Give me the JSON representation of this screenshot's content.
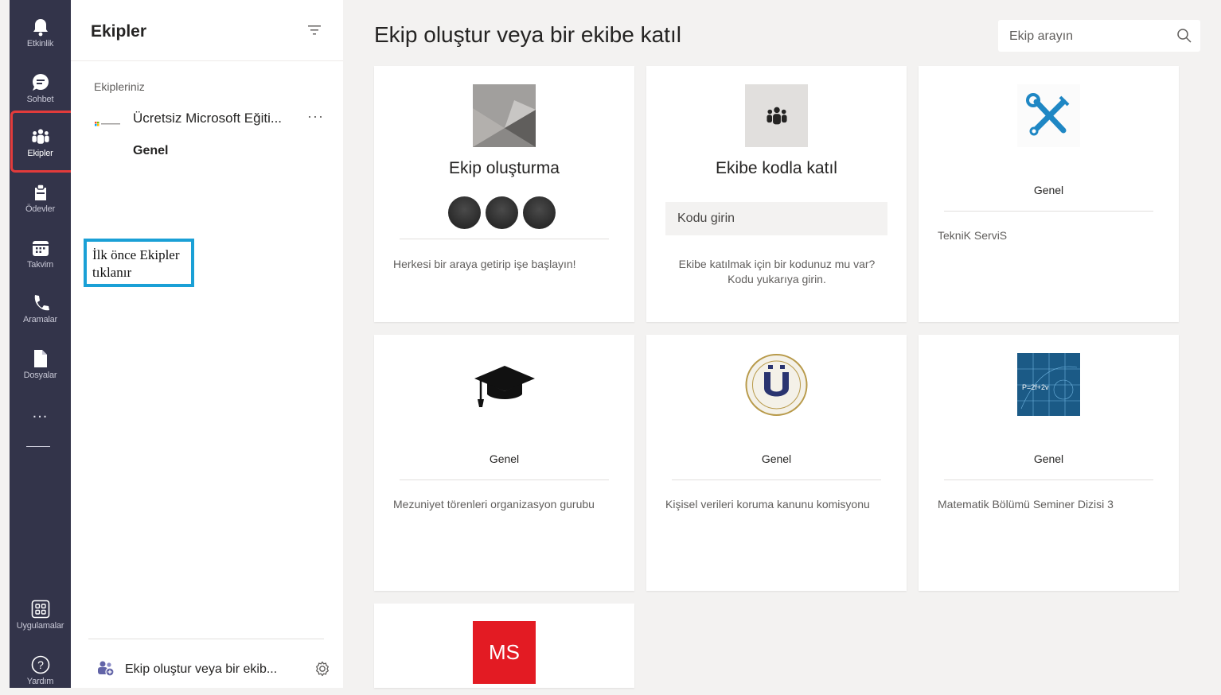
{
  "rail": {
    "items": [
      {
        "label": "Etkinlik",
        "icon": "bell-icon"
      },
      {
        "label": "Sohbet",
        "icon": "chat-icon"
      },
      {
        "label": "Ekipler",
        "icon": "teams-icon"
      },
      {
        "label": "Ödevler",
        "icon": "assignments-icon"
      },
      {
        "label": "Takvim",
        "icon": "calendar-icon"
      },
      {
        "label": "Aramalar",
        "icon": "phone-icon"
      },
      {
        "label": "Dosyalar",
        "icon": "file-icon"
      }
    ],
    "more": "...",
    "bottom": [
      {
        "label": "Uygulamalar",
        "icon": "apps-icon"
      },
      {
        "label": "Yardım",
        "icon": "help-icon"
      }
    ]
  },
  "annotation": {
    "text": "İlk önce Ekipler tıklanır",
    "box_color": "#1aa0d6",
    "highlight_color": "#e23b3b"
  },
  "panel": {
    "title": "Ekipler",
    "section_label": "Ekipleriniz",
    "team": {
      "name": "Ücretsiz Microsoft Eğiti...",
      "more": "···",
      "channel": "Genel"
    },
    "create": "Ekip oluştur veya bir ekib..."
  },
  "main": {
    "title": "Ekip oluştur veya bir ekibe katıl",
    "search_placeholder": "Ekip arayın",
    "cards": [
      {
        "title": "Ekip oluşturma",
        "desc": "Herkesi bir araya getirip işe başlayın!"
      },
      {
        "title": "Ekibe kodla katıl",
        "code_placeholder": "Kodu girin",
        "desc": "Ekibe katılmak için bir kodunuz mu var? Kodu yukarıya girin."
      },
      {
        "sub": "Genel",
        "desc": "TekniK ServiS"
      },
      {
        "sub": "Genel",
        "desc": "Mezuniyet törenleri organizasyon gurubu"
      },
      {
        "sub": "Genel",
        "desc": "Kişisel verileri koruma kanunu komisyonu"
      },
      {
        "sub": "Genel",
        "desc": "Matematik Bölümü Seminer Dizisi 3",
        "image_text": "P=2f+2v"
      },
      {
        "logo": "MS"
      }
    ]
  },
  "colors": {
    "rail": "#33344a",
    "accent": "#6264a7",
    "background": "#f3f2f1"
  }
}
